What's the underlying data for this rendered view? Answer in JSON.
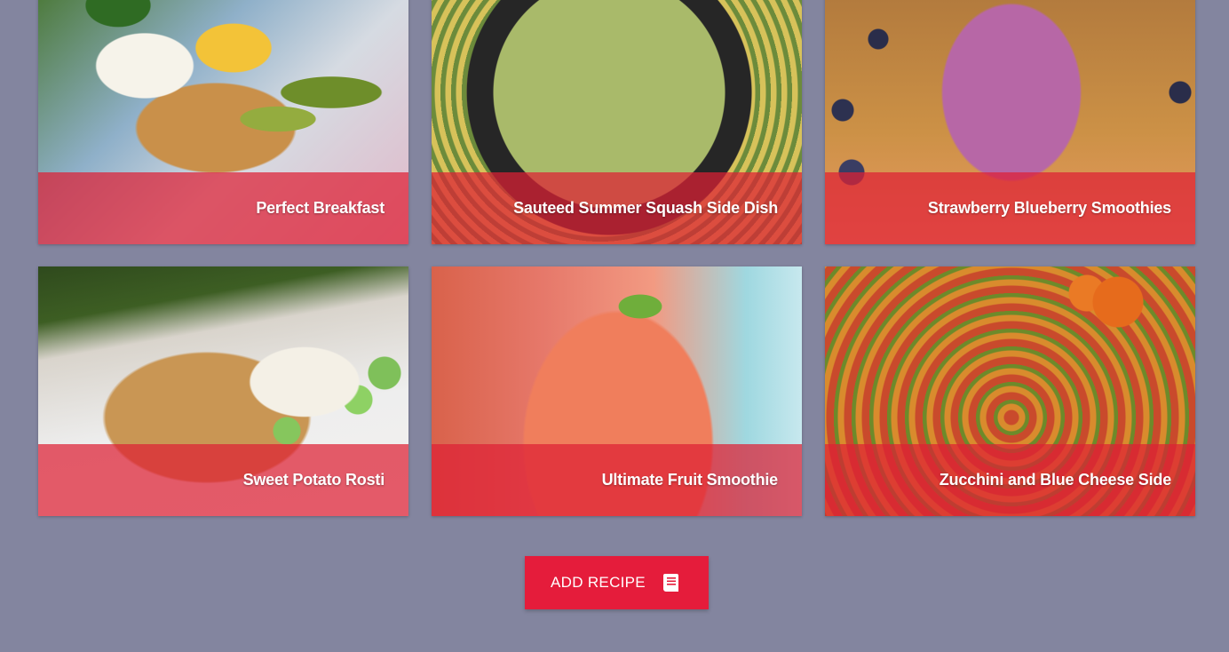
{
  "recipes": [
    {
      "title": "Perfect Breakfast",
      "image": "perfect-breakfast-photo"
    },
    {
      "title": "Sauteed Summer Squash Side Dish",
      "image": "sauteed-squash-photo"
    },
    {
      "title": "Strawberry Blueberry Smoothies",
      "image": "berry-smoothie-photo"
    },
    {
      "title": "Sweet Potato Rosti",
      "image": "sweet-potato-rosti-photo"
    },
    {
      "title": "Ultimate Fruit Smoothie",
      "image": "fruit-smoothie-photo"
    },
    {
      "title": "Zucchini and Blue Cheese Side",
      "image": "zucchini-side-photo"
    }
  ],
  "actions": {
    "add_recipe_label": "ADD RECIPE",
    "add_recipe_icon": "book-icon"
  },
  "colors": {
    "background": "#83859f",
    "accent": "#e51c3b",
    "card_overlay": "rgba(222, 32, 52, 0.72)"
  }
}
